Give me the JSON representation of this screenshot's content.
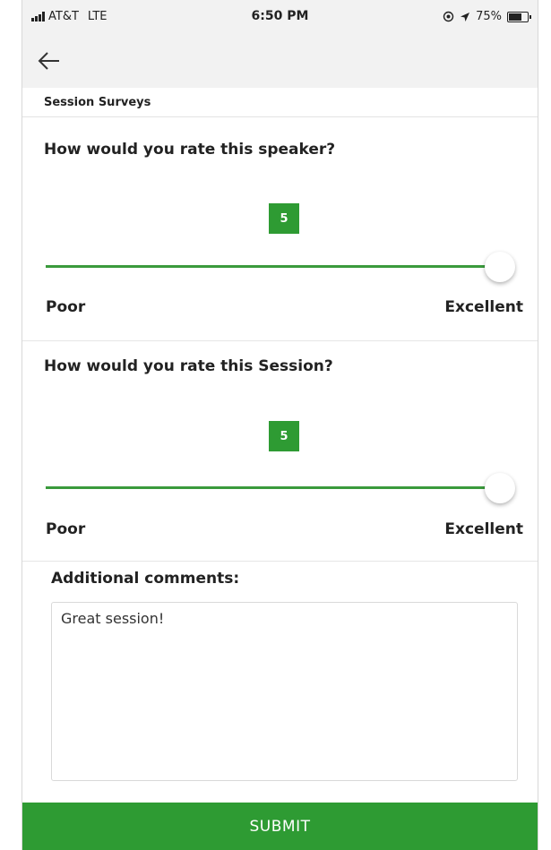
{
  "status_bar": {
    "carrier": "AT&T",
    "network": "LTE",
    "time": "6:50 PM",
    "battery": "75%",
    "battery_level": 0.75,
    "icons": [
      "signal-icon",
      "location-lock-icon",
      "location-arrow-icon",
      "battery-icon"
    ]
  },
  "nav": {
    "back_icon": "back-arrow-icon"
  },
  "header": {
    "title": "Session Surveys"
  },
  "questions": [
    {
      "title": "How would you rate this speaker?",
      "value": "5",
      "slider_level": 1.0,
      "min_label": "Poor",
      "max_label": "Excellent"
    },
    {
      "title": "How would you rate this Session?",
      "value": "5",
      "slider_level": 1.0,
      "min_label": "Poor",
      "max_label": "Excellent"
    }
  ],
  "comments": {
    "label": "Additional comments:",
    "value": "Great session!"
  },
  "submit": {
    "label": "SUBMIT"
  },
  "colors": {
    "accent": "#2e9b33",
    "bar_background": "#f2f2f2"
  }
}
